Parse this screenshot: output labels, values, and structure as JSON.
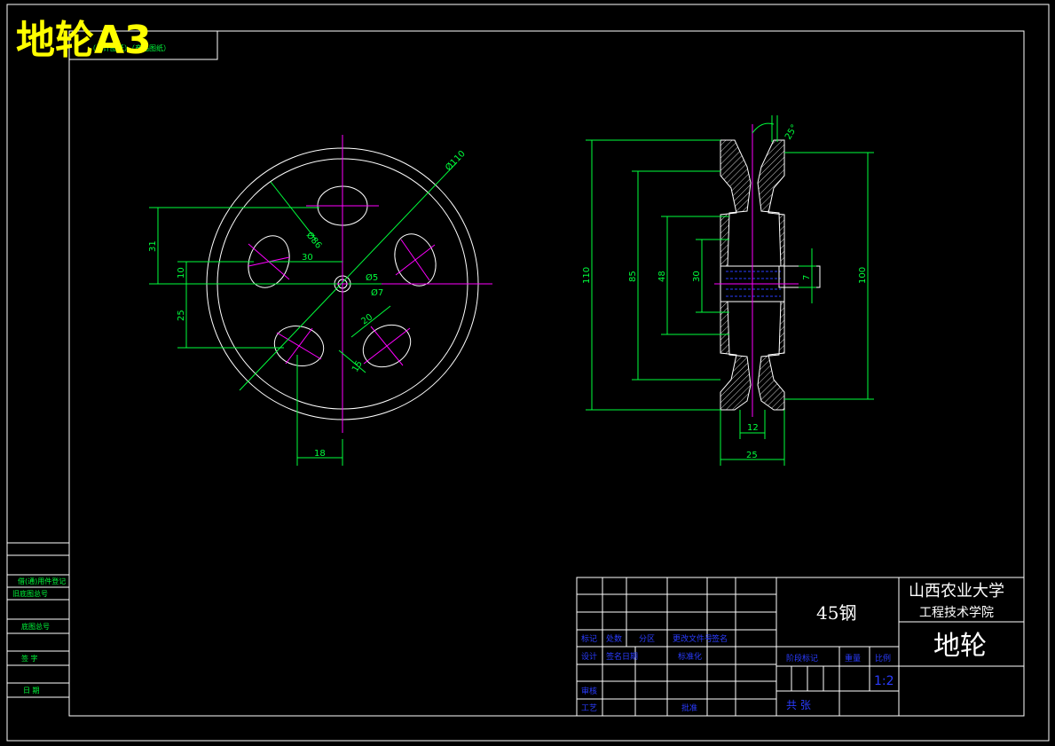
{
  "sheet": {
    "title": "地轮A3",
    "header_note": "（设计图纸）（产品图纸）"
  },
  "side_strip": {
    "labels": [
      "借(通)用件登记",
      "旧底图总号",
      "底图总号",
      "签  字",
      "日  期"
    ]
  },
  "title_block": {
    "material": "45钢",
    "school": "山西农业大学",
    "college": "工程技术学院",
    "part_name": "地轮",
    "scale": "1:2",
    "row_labels_1": [
      "标记",
      "处数",
      "分区",
      "更改文件号",
      "签名"
    ],
    "row_labels_2": [
      "设计",
      "签名日期",
      "",
      "标准化"
    ],
    "review": "审核",
    "process": "工艺",
    "approve": "批准",
    "stage_label": "阶段标记",
    "weight_label": "重量",
    "scale_label": "比例",
    "sheets_label": "共    张"
  },
  "front_view": {
    "dims": {
      "d110": "Ø110",
      "d86": "Ø86",
      "d5": "Ø5",
      "d7": "Ø7",
      "v31": "31",
      "v30": "30",
      "v10": "10",
      "v25": "25",
      "v20": "20",
      "v15": "15",
      "v18": "18"
    }
  },
  "section_view": {
    "dims": {
      "h110": "110",
      "h85": "85",
      "h48": "48",
      "h30": "30",
      "h7": "7",
      "h100": "100",
      "w12": "12",
      "w25": "25",
      "angle": "25°"
    }
  },
  "colors": {
    "outline": "#ffffff",
    "dimension": "#00ff3c",
    "center": "#ff00ff",
    "title": "#ffff00",
    "label": "#2a3cff",
    "hatch": "#ffffff"
  }
}
